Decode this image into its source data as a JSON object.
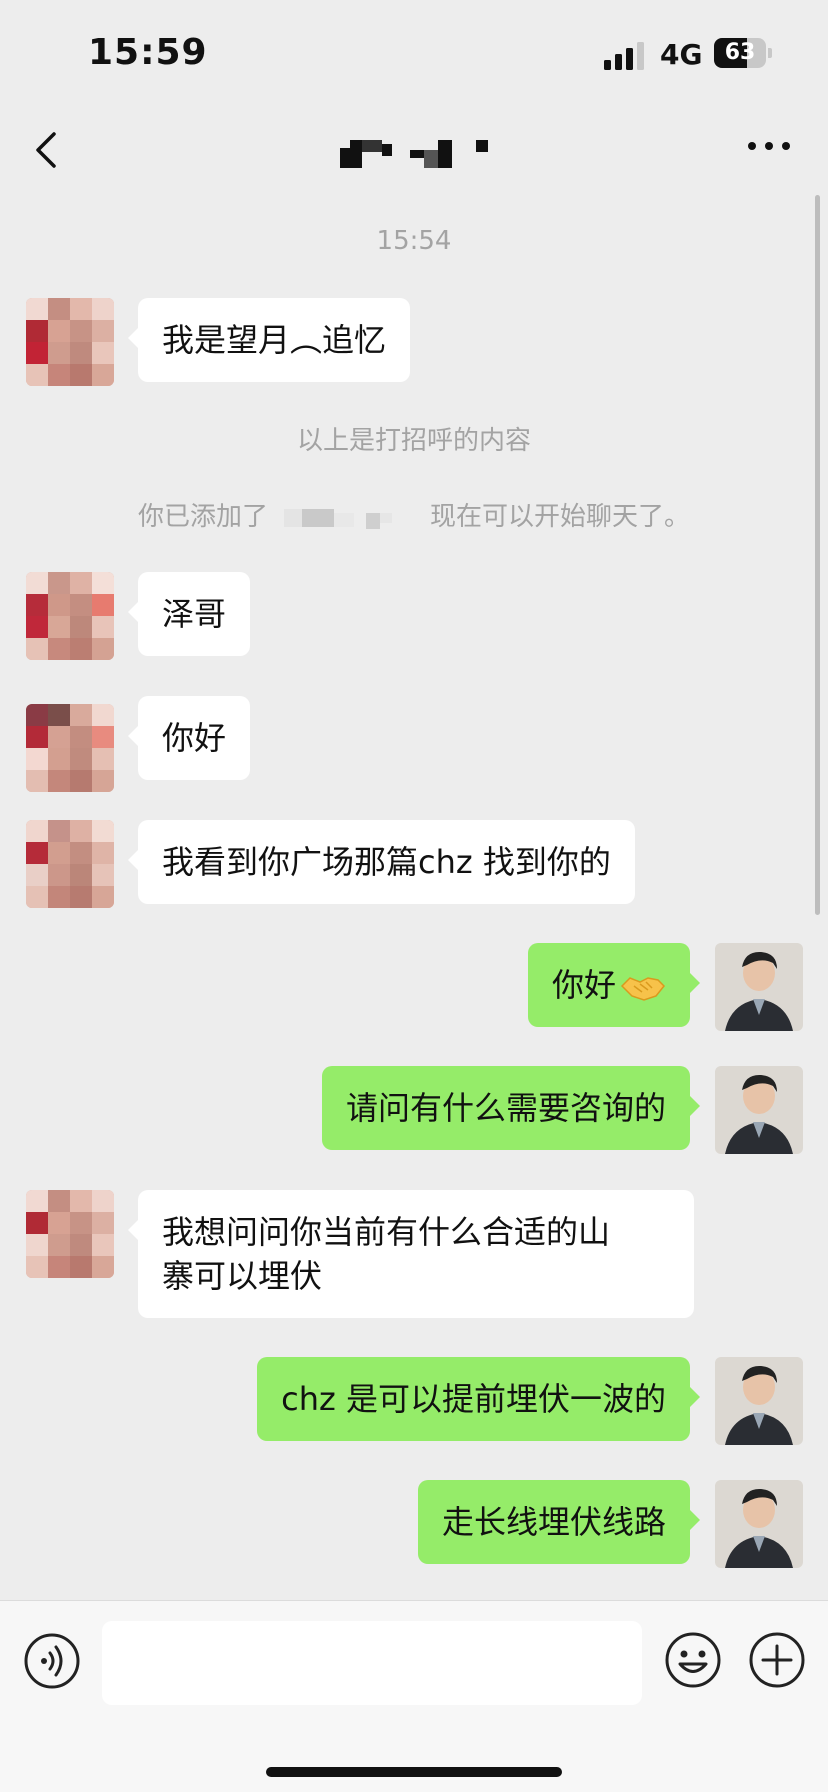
{
  "status_bar": {
    "time": "15:59",
    "network": "4G",
    "battery": "63",
    "battery_level_percent": 63
  },
  "nav": {
    "back_icon": "chevron-left-icon",
    "title_icon": "blurred-contact-name",
    "more_icon": "more-dots-icon"
  },
  "chat": {
    "timestamp": "15:54",
    "greeting_note": "以上是打招呼的内容",
    "added_note_prefix": "你已添加了",
    "added_note_suffix": "现在可以开始聊天了。",
    "messages": [
      {
        "side": "left",
        "text": "我是望月︵追忆"
      },
      {
        "side": "left",
        "text": "泽哥"
      },
      {
        "side": "left",
        "text": "你好"
      },
      {
        "side": "left",
        "text": "我看到你广场那篇chz 找到你的"
      },
      {
        "side": "right",
        "text": "你好",
        "emoji": "handshake-emoji"
      },
      {
        "side": "right",
        "text": "请问有什么需要咨询的"
      },
      {
        "side": "left",
        "text_line1": "我想问问你当前有什么合适的山",
        "text_line2": "寨可以埋伏"
      },
      {
        "side": "right",
        "text": "chz 是可以提前埋伏一波的"
      },
      {
        "side": "right",
        "text": "走长线埋伏线路"
      }
    ]
  },
  "input_bar": {
    "voice_icon": "voice-icon",
    "input_value": "",
    "emoji_icon": "smiley-icon",
    "plus_icon": "plus-icon"
  },
  "colors": {
    "background": "#ededed",
    "bubble_left": "#ffffff",
    "bubble_right": "#95ec69",
    "system_text": "#a3a3a3"
  }
}
